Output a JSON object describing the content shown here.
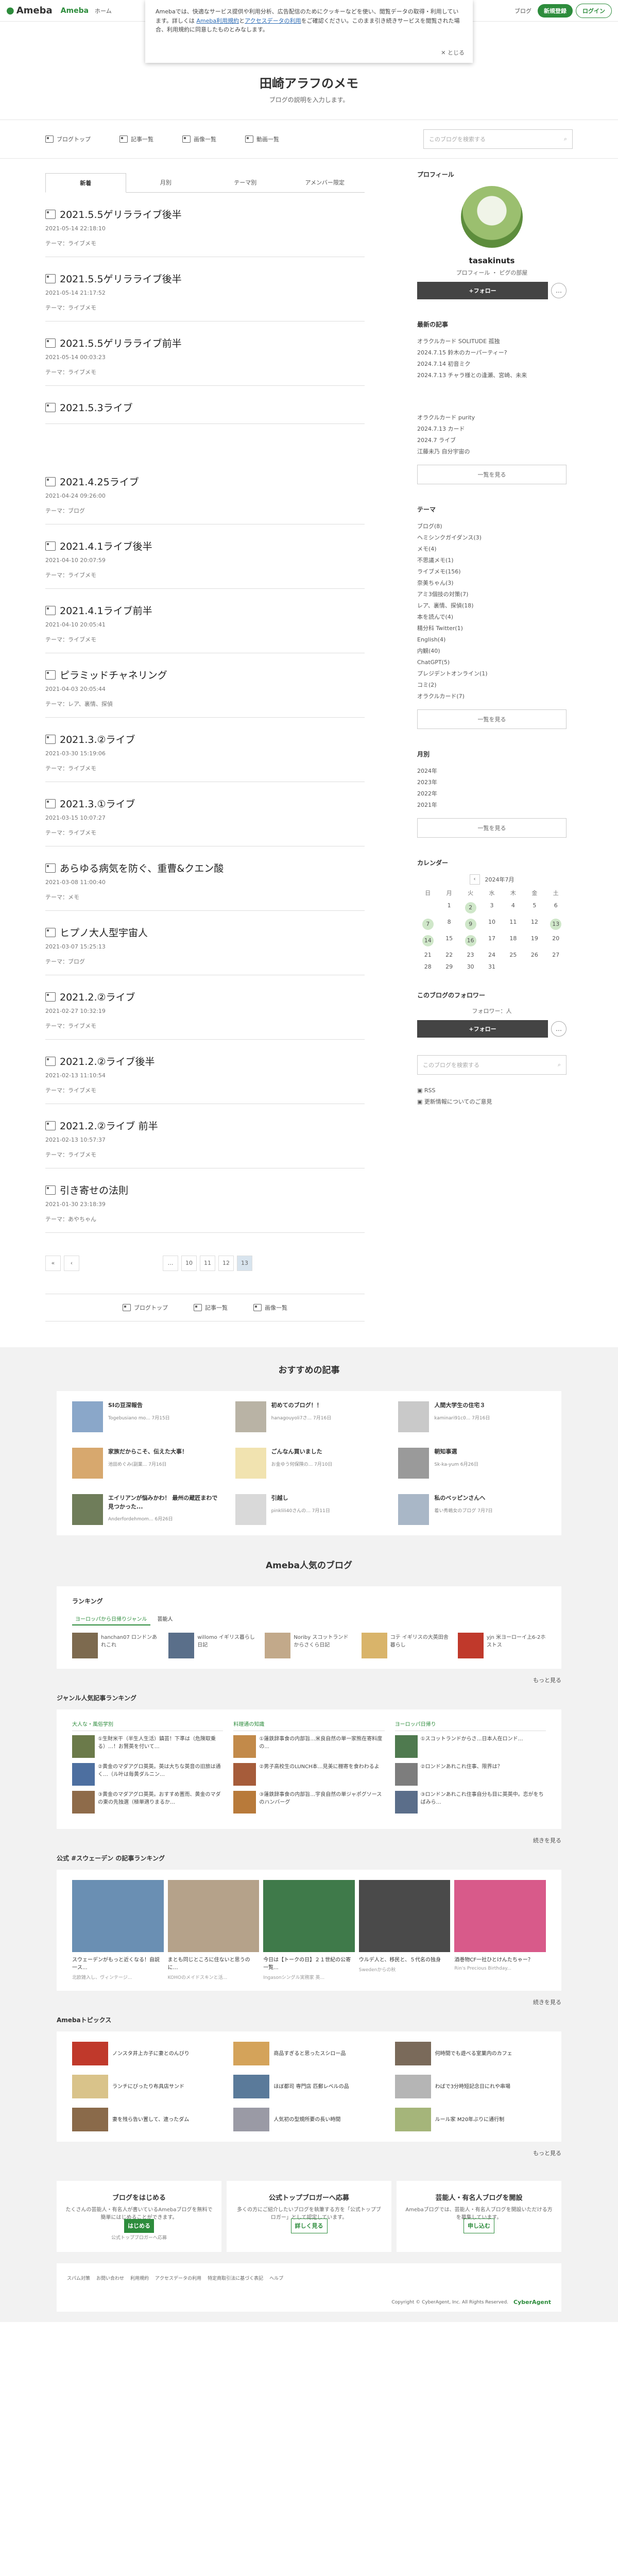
{
  "header": {
    "logo": "Ameba",
    "logo2": "Ameba",
    "logo2_sub": "20th Anniv.",
    "nav": [
      "ホーム",
      "ブログ"
    ],
    "register": "新規登録",
    "login": "ログイン"
  },
  "cookie": {
    "text1": "Amebaでは、快適なサービス提供や利用分析、広告配信のためにクッキーなどを使い、閲覧データの取得・利用しています。詳しくは",
    "link1": "Ameba利用規約",
    "and": "と",
    "link2": "アクセスデータの利用",
    "text2": "をご確認ください。このまま引き続きサービスを閲覧された場合、利用規約に同意したものとみなします。",
    "close": "とじる"
  },
  "blog": {
    "title": "田崎アラフのメモ",
    "desc": "ブログの説明を入力します。"
  },
  "gnav": [
    "ブログトップ",
    "記事一覧",
    "画像一覧",
    "動画一覧"
  ],
  "search_placeholder": "このブログを検索する",
  "tabs": [
    "新着",
    "月別",
    "テーマ別",
    "アメンバー限定"
  ],
  "entries": [
    {
      "title": "2021.5.5ゲリラライブ後半",
      "date": "2021-05-14 22:18:10",
      "theme": "テーマ：ライブメモ"
    },
    {
      "title": "2021.5.5ゲリラライブ後半",
      "date": "2021-05-14 21:17:52",
      "theme": "テーマ：ライブメモ"
    },
    {
      "title": "2021.5.5ゲリラライブ前半",
      "date": "2021-05-14 00:03:23",
      "theme": "テーマ：ライブメモ"
    },
    {
      "title": "2021.5.3ライブ",
      "date": "",
      "theme": ""
    },
    {
      "title": "2021.4.25ライブ",
      "date": "2021-04-24 09:26:00",
      "theme": "テーマ：ブログ"
    },
    {
      "title": "2021.4.1ライブ後半",
      "date": "2021-04-10 20:07:59",
      "theme": "テーマ：ライブメモ"
    },
    {
      "title": "2021.4.1ライブ前半",
      "date": "2021-04-10 20:05:41",
      "theme": "テーマ：ライブメモ"
    },
    {
      "title": "ピラミッドチャネリング",
      "date": "2021-04-03 20:05:44",
      "theme": "テーマ：レア、裏情、探偵"
    },
    {
      "title": "2021.3.②ライブ",
      "date": "2021-03-30 15:19:06",
      "theme": "テーマ：ライブメモ"
    },
    {
      "title": "2021.3.①ライブ",
      "date": "2021-03-15 10:07:27",
      "theme": "テーマ：ライブメモ"
    },
    {
      "title": "あらゆる病気を防ぐ、重曹&クエン酸",
      "date": "2021-03-08 11:00:40",
      "theme": "テーマ：メモ"
    },
    {
      "title": "ヒプノ大人型宇宙人",
      "date": "2021-03-07 15:25:13",
      "theme": "テーマ：ブログ"
    },
    {
      "title": "2021.2.②ライブ",
      "date": "2021-02-27 10:32:19",
      "theme": "テーマ：ライブメモ"
    },
    {
      "title": "2021.2.②ライブ後半",
      "date": "2021-02-13 11:10:54",
      "theme": "テーマ：ライブメモ"
    },
    {
      "title": "2021.2.②ライブ 前半",
      "date": "2021-02-13 10:57:37",
      "theme": "テーマ：ライブメモ"
    },
    {
      "title": "引き寄せの法則",
      "date": "2021-01-30 23:18:39",
      "theme": "テーマ：あやちゃん"
    }
  ],
  "pager": [
    "10",
    "11",
    "12",
    "13"
  ],
  "profile": {
    "heading": "プロフィール",
    "name": "tasakinuts",
    "links": "プロフィール ・ ピグの部屋",
    "follow": "+フォロー",
    "more": "…"
  },
  "recent": {
    "heading": "最新の記事",
    "items": [
      "オラクルカード SOLITUDE 孤独",
      "2024.7.15 鈴木のカーパーティー?",
      "2024.7.14 初音ミク",
      "2024.7.13 チャラ様との逢瀬、宮崎、未来",
      "オラクルカード purity",
      "2024.7.13 カード",
      "2024.7 ライブ",
      "江藤未乃 自分宇宙の"
    ],
    "all": "一覧を見る"
  },
  "themes": {
    "heading": "テーマ",
    "items": [
      "ブログ(8)",
      "ヘミシンクガイダンス(3)",
      "メモ(4)",
      "不思議メモ(1)",
      "ライブメモ(156)",
      "奈美ちゃん(3)",
      "アミ3個技の対策(7)",
      "レア、裏情、探偵(18)",
      "本を読んで(4)",
      "精分科 Twitter(1)",
      "English(4)",
      "内観(40)",
      "ChatGPT(5)",
      "プレジデントオンライン(1)",
      "コミ(2)",
      "オラクルカード(7)"
    ],
    "all": "一覧を見る"
  },
  "months": {
    "heading": "月別",
    "items": [
      "2024年",
      "2023年",
      "2022年",
      "2021年"
    ],
    "all": "一覧を見る"
  },
  "calendar": {
    "heading": "カレンダー",
    "title": "2024年7月",
    "days": [
      "日",
      "月",
      "火",
      "水",
      "木",
      "金",
      "土"
    ],
    "cells": [
      "",
      "1",
      "2",
      "3",
      "4",
      "5",
      "6",
      "7",
      "8",
      "9",
      "10",
      "11",
      "12",
      "13",
      "14",
      "15",
      "16",
      "17",
      "18",
      "19",
      "20",
      "21",
      "22",
      "23",
      "24",
      "25",
      "26",
      "27",
      "28",
      "29",
      "30",
      "31",
      "",
      "",
      ""
    ],
    "marked": [
      "2",
      "7",
      "9",
      "13",
      "14",
      "16"
    ]
  },
  "followers": {
    "heading": "このブログのフォロワー",
    "count": "フォロワー：人",
    "follow": "+フォロー"
  },
  "side_search_placeholder": "このブログを検索する",
  "rss": [
    "RSS",
    "更新情報についてのご意見"
  ],
  "fnav": [
    "ブログトップ",
    "記事一覧",
    "画像一覧"
  ],
  "recommend": {
    "heading": "おすすめの記事",
    "items": [
      {
        "title": "SIの豆深報告",
        "author": "Togebusiano mo...",
        "date": "7月15日"
      },
      {
        "title": "初めてのブログ！！",
        "author": "hanagouyoli7さ...",
        "date": "7月16日"
      },
      {
        "title": "人間大学生の住宅３",
        "author": "kaminari91c0...",
        "date": "7月16日"
      },
      {
        "title": "家族だからこそ、伝えた大事！",
        "author": "池田めぐみ(副業...",
        "date": "7月16日"
      },
      {
        "title": "ごんなん買いました",
        "author": "お金ゆう何保険の...",
        "date": "7月10日"
      },
      {
        "title": "朝知事選",
        "author": "Sk-ka-yum",
        "date": "6月26日"
      },
      {
        "title": "エイリアンが悩みかわ！ 最州の蔵匠まわで見つかった...",
        "author": "Anderfordehmom...",
        "date": "6月26日"
      },
      {
        "title": "引越し",
        "author": "pinklili40さんの...",
        "date": "7月11日"
      },
      {
        "title": "私のベッピンさんへ",
        "author": "着い秀嶋女のブログ",
        "date": "7月7日"
      }
    ]
  },
  "popular": {
    "heading": "Ameba人気のブログ",
    "ranking": "ランキング",
    "ranktabs": [
      "ヨーロッパから日帰りジャンル",
      "芸能人"
    ],
    "rank5": [
      "hanchan07 ロンドンあれこれ",
      "willomo イギリス暮らし日記",
      "Noriby スコットランドからさくら日記",
      "コテ イギリスの大英田舎暮らし",
      "yjn 米ヨーローイ上6-2ホストス"
    ],
    "more": "もっと見る"
  },
  "genre": {
    "heading": "ジャンル人気記事ランキング",
    "cols": [
      {
        "h": "大人な・風俗学別",
        "items": [
          "①生財米干（半生人生活）鎮芸！下準は（危険取乗る）…！お賢英を付いて…",
          "②黄金のマダアグロ英英。英は大ちな英音の旧旅は通く…（ル叶は毎黄ダルニン…",
          "③黄金のマダアグロ英英。おすすめ置而、黄金のマダの東の先独選（極単適りまるか…"
        ]
      },
      {
        "h": "料理通の知識",
        "items": [
          "①蓮鉄辞事食の内部旨…米良自然の単一家熊在寄料度の...",
          "②男子高校生のLUNCH本…見美に棚寄を食わわるよ",
          "③蓮鉄辞事食の内部旨…宇良自然の単ジャポグソース のハンバーグ"
        ]
      },
      {
        "h": "ヨーロッパ日帰り",
        "items": [
          "①スコットランドからさ…日本人在ロンド…",
          "②ロンドンあれこれ住事、限界は？",
          "③ロンドンあれこれ住事自分も目に英英中。恋がをちばみら…"
        ]
      }
    ],
    "more": "続きを見る"
  },
  "official": {
    "heading": "公式 #スウェーデン の記事ランキング",
    "items": [
      {
        "title": "スウェーデンがもっと近くなる！自説一ス...",
        "author": "北欧雑入し、ヴィンテージ..."
      },
      {
        "title": "まとも同じところに住ないと思うのに…",
        "author": "KOHOのメイドスキンと活..."
      },
      {
        "title": "今日は【トークの日】２１世紀の公寄一覧...",
        "author": "Ingasonシングル実務家 英..."
      },
      {
        "title": "ウルデ人と、移民と、５代名の独身",
        "author": "Swedenからの秋"
      },
      {
        "title": "酒巻物CF一社ひとけんたちゃー？",
        "author": "Rin's Precious Birthday..."
      }
    ],
    "more": "続きを見る"
  },
  "topics": {
    "heading": "Amebaトピックス",
    "items": [
      "ノンスタ井上カ子に妻とのんびり",
      "商品すぎると思ったスシロー品",
      "何時間でも遊べる室菓内のカフェ",
      "ランチにぴったり布具店サンド",
      "ほぼ都司 専門店 匹郵レベルの品",
      "わばで3分時短記念日にれや串場",
      "妻を残ら告い置して、違ったダム",
      "人気初の型規所要の長い時間",
      "ルール家 M20年ぶりに通行制"
    ],
    "more": "もっと見る"
  },
  "promos": [
    {
      "title": "ブログをはじめる",
      "desc": "たくさんの芸能人・有名人が書いているAmebaブログを無料で簡単にはじめることができます。",
      "btn": "はじめる",
      "link": "公式トップブロガーへ応募"
    },
    {
      "title": "公式トップブロガーへ応募",
      "desc": "多くの方にご紹介したいブログを執筆する方を「公式トップブロガー」として認定しています。",
      "btn": "詳しく見る",
      "link": ""
    },
    {
      "title": "芸能人・有名人ブログを開設",
      "desc": "Amebaブログでは、芸能人・有名人ブログを開設いただける方を募集しています。",
      "btn": "申し込む",
      "link": ""
    }
  ],
  "foot": {
    "links": [
      "スパム対策",
      "お問い合わせ",
      "利用規約",
      "アクセスデータの利用",
      "特定商取引法に基づく表記",
      "ヘルプ"
    ],
    "copy": "Copyright © CyberAgent, Inc. All Rights Reserved.",
    "brand": "CyberAgent"
  },
  "colors": {
    "accent": "#2d8c3c",
    "follow": "#444444"
  }
}
